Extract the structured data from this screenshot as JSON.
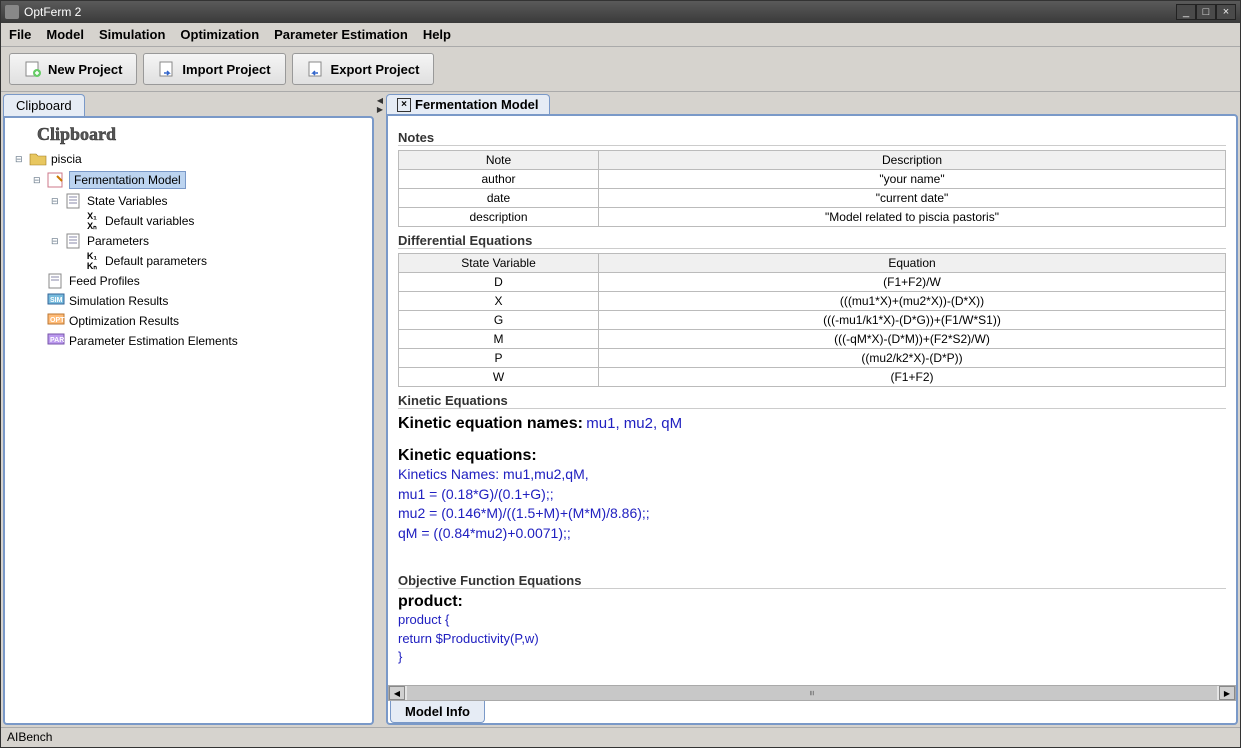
{
  "title": "OptFerm 2",
  "menu": {
    "file": "File",
    "model": "Model",
    "simulation": "Simulation",
    "optimization": "Optimization",
    "paramest": "Parameter Estimation",
    "help": "Help"
  },
  "toolbar": {
    "new": "New Project",
    "import": "Import Project",
    "export": "Export Project"
  },
  "left_tab": "Clipboard",
  "clip_title": "Clipboard",
  "tree": {
    "proj": "piscia",
    "model": "Fermentation Model",
    "statevars": "State Variables",
    "defvars": "Default variables",
    "params": "Parameters",
    "defparams": "Default parameters",
    "feed": "Feed Profiles",
    "sim": "Simulation Results",
    "opt": "Optimization Results",
    "pest": "Parameter Estimation Elements"
  },
  "right_tab": "Fermentation Model",
  "sections": {
    "notes": "Notes",
    "diffeq": "Differential Equations",
    "kinetic": "Kinetic Equations",
    "objfn": "Objective Function Equations"
  },
  "notes": {
    "th_note": "Note",
    "th_desc": "Description",
    "r0n": "author",
    "r0d": "\"your name\"",
    "r1n": "date",
    "r1d": "\"current date\"",
    "r2n": "description",
    "r2d": "\"Model related to piscia pastoris\""
  },
  "diffeq": {
    "th_sv": "State Variable",
    "th_eq": "Equation",
    "r0s": "D",
    "r0e": "(F1+F2)/W",
    "r1s": "X",
    "r1e": "(((mu1*X)+(mu2*X))-(D*X))",
    "r2s": "G",
    "r2e": "(((-mu1/k1*X)-(D*G))+(F1/W*S1))",
    "r3s": "M",
    "r3e": "(((-qM*X)-(D*M))+(F2*S2)/W)",
    "r4s": "P",
    "r4e": "((mu2/k2*X)-(D*P))",
    "r5s": "W",
    "r5e": "(F1+F2)"
  },
  "kin": {
    "names_label": "Kinetic equation names:",
    "names_val": "mu1, mu2, qM",
    "eq_label": "Kinetic equations:",
    "l0": "Kinetics Names: mu1,mu2,qM,",
    "l1": "mu1 = (0.18*G)/(0.1+G);;",
    "l2": "mu2 = (0.146*M)/((1.5+M)+(M*M)/8.86);;",
    "l3": "qM = ((0.84*mu2)+0.0071);;"
  },
  "obj": {
    "prod_label": "product:",
    "l0": "product    {",
    "l1": "return $Productivity(P,w)",
    "l2": "}"
  },
  "bottom_tab": "Model Info",
  "status": "AIBench"
}
